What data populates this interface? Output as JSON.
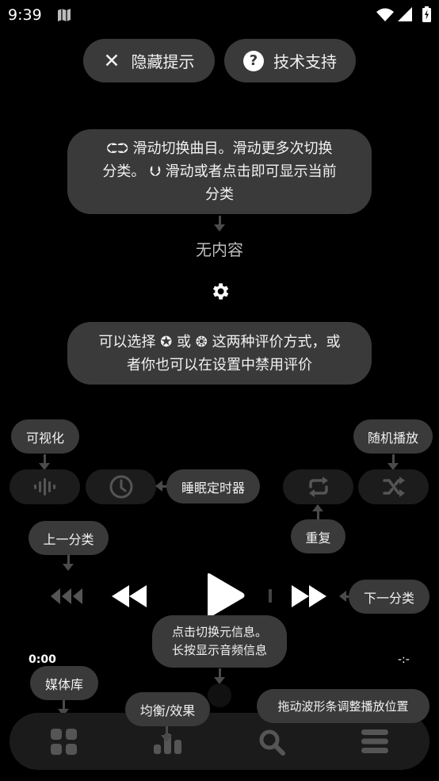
{
  "status_bar": {
    "time": "9:39"
  },
  "top_buttons": {
    "hide_tips": "隐藏提示",
    "tech_support": "技术支持"
  },
  "swipe_tip": {
    "line1": "滑动切换曲目。滑动更多次切换",
    "line2": "分类。",
    "line2b": "滑动或者点击即可显示当前",
    "line3": "分类"
  },
  "empty_text": "无内容",
  "rating_tip": {
    "line1a": "可以选择",
    "line1b": "或",
    "line1c": "这两种评价方式，或",
    "line2": "者你也可以在设置中禁用评价"
  },
  "tips": {
    "visualizer": "可视化",
    "shuffle": "随机播放",
    "sleep_timer": "睡眠定时器",
    "repeat": "重复",
    "prev_category": "上一分类",
    "next_category": "下一分类",
    "meta_tip_line1": "点击切换元信息。",
    "meta_tip_line2": "长按显示音频信息",
    "library": "媒体库",
    "eq": "均衡/效果",
    "seek": "拖动波形条调整播放位置"
  },
  "playback": {
    "elapsed": "0:00",
    "duration": "-:-"
  },
  "colors": {
    "background": "#000000",
    "bubble": "#3a3a3a",
    "pill": "#1c1c1c",
    "icon_dim": "#555555"
  }
}
